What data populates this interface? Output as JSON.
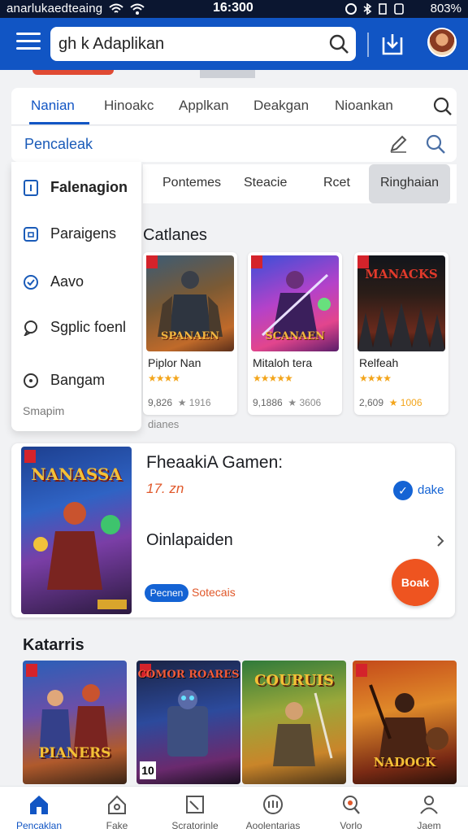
{
  "status_bar": {
    "left_text": "anarlukaedteaing",
    "time": "16:300",
    "right_text": "803%"
  },
  "app_bar": {
    "search_value": "gh k Adaplikan"
  },
  "tabs": {
    "items": [
      "Nanian",
      "Hinoakc",
      "Applkan",
      "Deakgan",
      "Nioankan"
    ],
    "active": "Nanian"
  },
  "sub_header": {
    "title": "Pencaleak"
  },
  "filter_chips": {
    "items": [
      "Pontemes",
      "Steacie",
      "Rcet",
      "Ringhaian"
    ],
    "selected": "Ringhaian"
  },
  "side_menu": {
    "items": [
      {
        "label": "Falenagion",
        "icon": "square-icon",
        "bold": true
      },
      {
        "label": "Paraigens",
        "icon": "lock-icon",
        "bold": false
      },
      {
        "label": "Aavo",
        "icon": "check-circle-icon",
        "bold": false
      },
      {
        "label": "Sgplic foenl",
        "icon": "chat-icon",
        "bold": false
      },
      {
        "label": "Bangam",
        "icon": "circle-dot-icon",
        "bold": false
      }
    ],
    "footer": "Smapim"
  },
  "catalog": {
    "title": "Catlanes",
    "footer": "dianes",
    "cards": [
      {
        "art_title": "SPANAEN",
        "name": "Piplor Nan",
        "stars": "★★★★",
        "count": "9,826",
        "rating": "★ 1916"
      },
      {
        "art_title": "SCANAEN",
        "name": "Mitaloh tera",
        "stars": "★★★★★",
        "count": "9,1886",
        "rating": "★ 3606"
      },
      {
        "art_title": "MANACKS",
        "name": "Relfeah",
        "stars": "★★★★",
        "count": "2,609",
        "rating": "★ 1006"
      }
    ]
  },
  "featured": {
    "art_title": "NANASSA",
    "title": "FheaakiA Gamen:",
    "subtitle": "17. zn",
    "chip_icon": "✓",
    "chip_label": "dake",
    "row_label": "Oinlapaiden",
    "pill_label": "Pecnen",
    "pill_text": "Sotecais",
    "round_button": "Boak"
  },
  "categories": {
    "title": "Katarris",
    "cards": [
      {
        "logo": "PIANERS"
      },
      {
        "logo": "COMOR ROARES",
        "badge": "10"
      },
      {
        "logo": "COURUIS"
      },
      {
        "logo": "NADOCK"
      }
    ]
  },
  "bottom_nav": {
    "items": [
      {
        "label": "Pencaklan",
        "icon": "home-icon",
        "active": true
      },
      {
        "label": "Fake",
        "icon": "house-outline-icon",
        "active": false
      },
      {
        "label": "Scratorinle",
        "icon": "image-icon",
        "active": false
      },
      {
        "label": "Aoolentarias",
        "icon": "community-icon",
        "active": false
      },
      {
        "label": "Vorlo",
        "icon": "search-heart-icon",
        "active": false
      },
      {
        "label": "Jaem",
        "icon": "person-icon",
        "active": false
      }
    ]
  },
  "colors": {
    "primary": "#1155c4",
    "accent": "#ee5420",
    "star": "#f3a51b"
  }
}
